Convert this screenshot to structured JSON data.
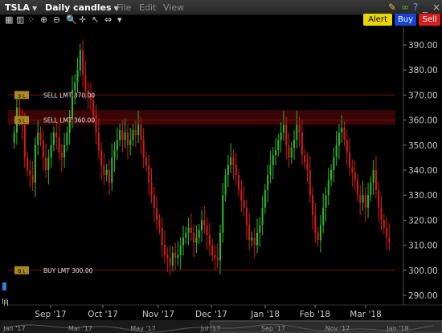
{
  "window": {
    "symbol": "TSLA",
    "chart_type": "Daily candles",
    "menus": [
      "File",
      "Edit",
      "View"
    ],
    "title_icons": [
      "wrench-icon",
      "chain-link-icon",
      "question-icon",
      "minimize-icon",
      "close-icon"
    ]
  },
  "action_buttons": {
    "alert": "Alert",
    "buy": "Buy",
    "sell": "Sell"
  },
  "toolbar": {
    "icons": [
      "table-icon",
      "bars-icon",
      "crosshair-dots-icon",
      "zoom-in-icon",
      "zoom-out-icon",
      "crosshair-icon",
      "pointer-icon",
      "resize-icon",
      "dropdown-icon"
    ]
  },
  "colors": {
    "up_candle": "#2db82d",
    "down_candle": "#d41b1b",
    "order_line": "#7a1010",
    "order_tag": "#a88a20",
    "axis_text": "#c8c8c8"
  },
  "orders": [
    {
      "tag": "S L",
      "label": "SELL LMT 370.00",
      "price": 370
    },
    {
      "tag": "S L",
      "label": "SELL LMT 360.00",
      "price": 360
    },
    {
      "tag": "B L",
      "label": "BUY LMT 300.00",
      "price": 300
    }
  ],
  "chart_data": {
    "type": "candlestick",
    "title": "",
    "x_ticks": [
      "Sep '17",
      "Oct '17",
      "Nov '17",
      "Dec '17",
      "Jan '18",
      "Feb '18",
      "Mar '18"
    ],
    "y_ticks": [
      390,
      380,
      370,
      360,
      350,
      340,
      330,
      320,
      310,
      300,
      290
    ],
    "ylim": [
      285,
      395
    ],
    "grid": false,
    "navigator_ticks": [
      "Jan '17",
      "Mar '17",
      "May '17",
      "Jul '17",
      "Sep '17",
      "Nov '17",
      "Jan '18"
    ],
    "closes": [
      355,
      365,
      361,
      358,
      345,
      340,
      338,
      335,
      350,
      355,
      352,
      345,
      340,
      345,
      350,
      355,
      353,
      347,
      345,
      350,
      355,
      360,
      372,
      375,
      380,
      388,
      378,
      372,
      370,
      368,
      362,
      355,
      348,
      342,
      338,
      340,
      335,
      345,
      348,
      352,
      356,
      352,
      355,
      350,
      352,
      356,
      354,
      358,
      352,
      345,
      342,
      335,
      330,
      325,
      320,
      317,
      310,
      306,
      305,
      302,
      307,
      305,
      306,
      310,
      313,
      315,
      317,
      315,
      311,
      313,
      316,
      320,
      318,
      314,
      310,
      306,
      305,
      304,
      315,
      330,
      338,
      342,
      345,
      342,
      338,
      332,
      328,
      325,
      318,
      312,
      313,
      310,
      315,
      318,
      325,
      332,
      338,
      342,
      346,
      348,
      352,
      355,
      358,
      350,
      345,
      349,
      352,
      358,
      355,
      346,
      343,
      340,
      330,
      322,
      315,
      312,
      318,
      325,
      330,
      336,
      340,
      345,
      350,
      355,
      357,
      352,
      347,
      341,
      339,
      336,
      330,
      327,
      330,
      325,
      330,
      335,
      340,
      332,
      325,
      320,
      317,
      313,
      311
    ]
  }
}
